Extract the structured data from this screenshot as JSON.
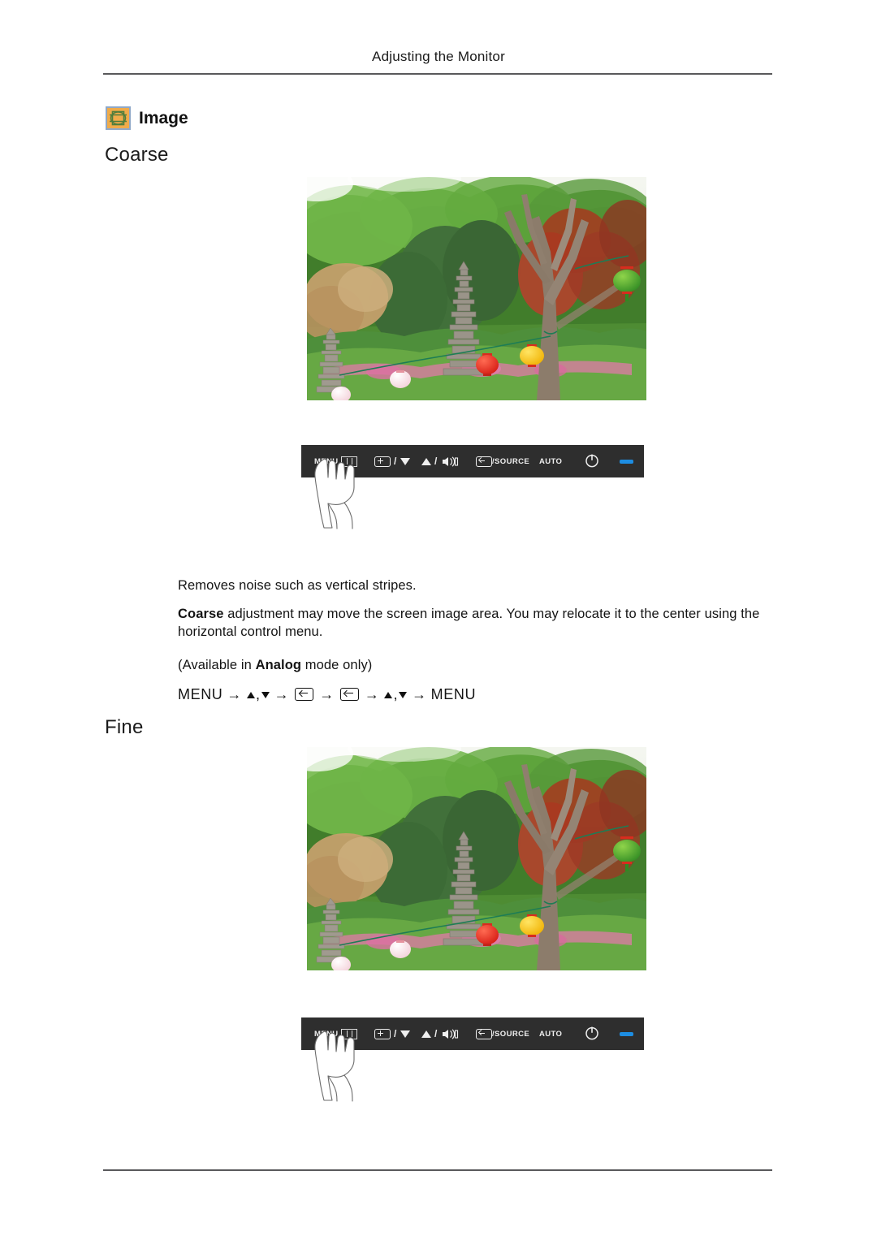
{
  "header": {
    "title": "Adjusting the Monitor"
  },
  "section": {
    "icon_name": "image-menu-icon",
    "label": "Image",
    "icon_bg": "#f0ab4a",
    "icon_border": "#8fa8c8"
  },
  "subsections": [
    {
      "id": "coarse",
      "heading": "Coarse"
    },
    {
      "id": "fine",
      "heading": "Fine"
    }
  ],
  "photo": {
    "alt": "Korean temple garden with stone pagodas, green trees, red maple and colored paper lanterns"
  },
  "control_panel": {
    "menu_label": "MENU",
    "brightness_label": "",
    "separator": "/",
    "source_label": "/SOURCE",
    "auto_label": "AUTO",
    "power_label": "",
    "led_color": "#1d8de2",
    "background": "#2e2e2e",
    "text_color": "#efefef"
  },
  "body": {
    "p1": "Removes noise such as vertical stripes.",
    "p2_bold": "Coarse",
    "p2_rest": " adjustment may move the screen image area. You may relocate it to the center using the horizontal control menu.",
    "p3_pre": "(Available in ",
    "p3_bold": "Analog",
    "p3_post": " mode only)",
    "nav": {
      "start": "MENU",
      "end": "MENU",
      "arrow": "→",
      "comma": ","
    }
  }
}
